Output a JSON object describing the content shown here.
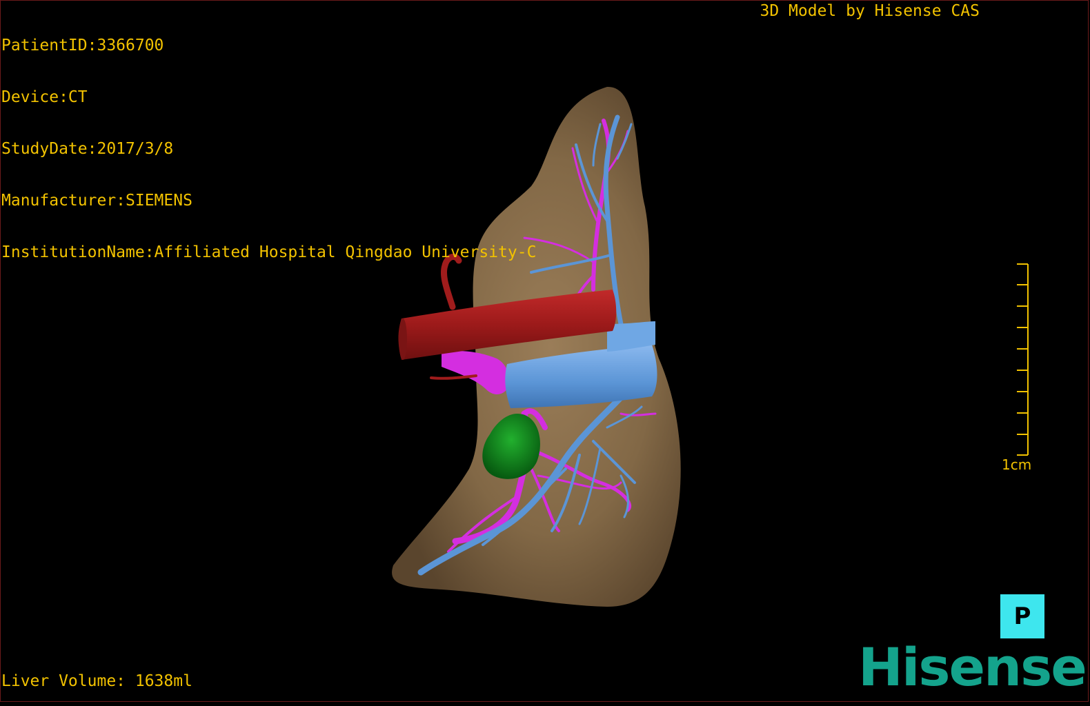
{
  "info": {
    "patient_id": "PatientID:3366700",
    "device": "Device:CT",
    "study_date": "StudyDate:2017/3/8",
    "manufacturer": "Manufacturer:SIEMENS",
    "institution": "InstitutionName:Affiliated Hospital Qingdao University-C"
  },
  "header": {
    "model_credit": "3D Model by Hisense CAS"
  },
  "footer": {
    "liver_volume": "Liver Volume: 1638ml"
  },
  "scale": {
    "label": "1cm"
  },
  "orientation": {
    "label": "P"
  },
  "brand": {
    "logo_text": "Hisense"
  },
  "colors": {
    "overlay_text": "#f2c200",
    "liver": "#8a6f4e",
    "hepatic_vein": "#5b95d6",
    "portal_vein": "#d42ee0",
    "ivc": "#a01c1c",
    "gallbladder": "#0f8a1e",
    "orientation_cube": "#3ee6ee",
    "logo": "#14a38c"
  }
}
